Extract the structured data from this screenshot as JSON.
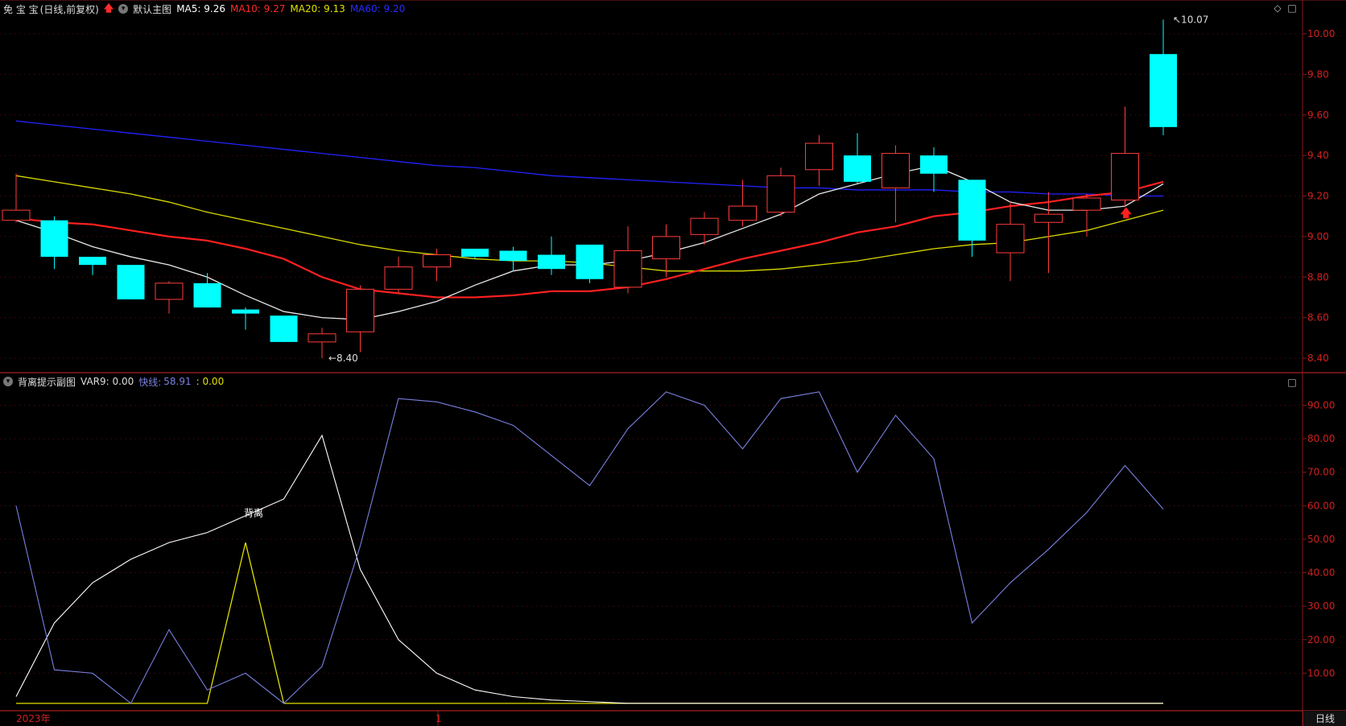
{
  "main_header": {
    "stock_name": "免 宝 宝",
    "period": "(日线,前复权)",
    "template": "默认主图",
    "ma5": "MA5: 9.26",
    "ma10": "MA10: 9.27",
    "ma20": "MA20: 9.13",
    "ma60": "MA60: 9.20",
    "colors": {
      "ma5": "#ffffff",
      "ma10": "#ff2a2a",
      "ma20": "#e0e000",
      "ma60": "#2222ff"
    }
  },
  "sub_header": {
    "title": "背离提示副图",
    "var9": "VAR9: 0.00",
    "fast_label": "快线:",
    "fast_value": "58.91",
    "yellow_value": ": 0.00"
  },
  "bottom": {
    "year_label": "2023年",
    "month_label": "1",
    "period_button": "日线"
  },
  "annotations": {
    "high": "10.07",
    "low": "←8.40",
    "divergence": "背离"
  },
  "chart_data": [
    {
      "type": "candlestick",
      "ylim": [
        8.32,
        10.1
      ],
      "yticks": [
        "10.00",
        "9.80",
        "9.60",
        "9.40",
        "9.20",
        "9.00",
        "8.80",
        "8.60",
        "8.40"
      ],
      "ytick_values": [
        10.0,
        9.8,
        9.6,
        9.4,
        9.2,
        9.0,
        8.8,
        8.6,
        8.4
      ],
      "candles": [
        {
          "o": 9.08,
          "h": 9.31,
          "l": 9.07,
          "c": 9.13
        },
        {
          "o": 9.08,
          "h": 9.1,
          "l": 8.84,
          "c": 8.9
        },
        {
          "o": 8.9,
          "h": 8.9,
          "l": 8.81,
          "c": 8.86
        },
        {
          "o": 8.86,
          "h": 8.86,
          "l": 8.69,
          "c": 8.69
        },
        {
          "o": 8.69,
          "h": 8.78,
          "l": 8.62,
          "c": 8.77
        },
        {
          "o": 8.77,
          "h": 8.82,
          "l": 8.65,
          "c": 8.65
        },
        {
          "o": 8.64,
          "h": 8.65,
          "l": 8.54,
          "c": 8.62
        },
        {
          "o": 8.61,
          "h": 8.61,
          "l": 8.48,
          "c": 8.48
        },
        {
          "o": 8.48,
          "h": 8.55,
          "l": 8.4,
          "c": 8.52
        },
        {
          "o": 8.53,
          "h": 8.76,
          "l": 8.43,
          "c": 8.74
        },
        {
          "o": 8.74,
          "h": 8.9,
          "l": 8.72,
          "c": 8.85
        },
        {
          "o": 8.85,
          "h": 8.94,
          "l": 8.78,
          "c": 8.91
        },
        {
          "o": 8.94,
          "h": 8.94,
          "l": 8.89,
          "c": 8.9
        },
        {
          "o": 8.93,
          "h": 8.95,
          "l": 8.83,
          "c": 8.88
        },
        {
          "o": 8.91,
          "h": 9.0,
          "l": 8.81,
          "c": 8.84
        },
        {
          "o": 8.96,
          "h": 8.96,
          "l": 8.77,
          "c": 8.79
        },
        {
          "o": 8.75,
          "h": 9.05,
          "l": 8.72,
          "c": 8.93
        },
        {
          "o": 8.89,
          "h": 9.06,
          "l": 8.8,
          "c": 9.0
        },
        {
          "o": 9.01,
          "h": 9.12,
          "l": 8.96,
          "c": 9.09
        },
        {
          "o": 9.08,
          "h": 9.28,
          "l": 9.05,
          "c": 9.15
        },
        {
          "o": 9.12,
          "h": 9.34,
          "l": 9.1,
          "c": 9.3
        },
        {
          "o": 9.33,
          "h": 9.5,
          "l": 9.25,
          "c": 9.46
        },
        {
          "o": 9.4,
          "h": 9.51,
          "l": 9.26,
          "c": 9.27
        },
        {
          "o": 9.24,
          "h": 9.45,
          "l": 9.07,
          "c": 9.41
        },
        {
          "o": 9.4,
          "h": 9.44,
          "l": 9.22,
          "c": 9.31
        },
        {
          "o": 9.28,
          "h": 9.28,
          "l": 8.9,
          "c": 8.98
        },
        {
          "o": 8.92,
          "h": 9.17,
          "l": 8.78,
          "c": 9.06
        },
        {
          "o": 9.07,
          "h": 9.22,
          "l": 8.82,
          "c": 9.11
        },
        {
          "o": 9.13,
          "h": 9.21,
          "l": 9.0,
          "c": 9.19
        },
        {
          "o": 9.18,
          "h": 9.64,
          "l": 9.15,
          "c": 9.41
        },
        {
          "o": 9.9,
          "h": 10.07,
          "l": 9.5,
          "c": 9.54
        }
      ],
      "ma5": [
        9.08,
        9.02,
        8.95,
        8.9,
        8.86,
        8.8,
        8.71,
        8.63,
        8.6,
        8.59,
        8.63,
        8.68,
        8.76,
        8.83,
        8.86,
        8.86,
        8.88,
        8.92,
        8.97,
        9.04,
        9.11,
        9.21,
        9.26,
        9.31,
        9.35,
        9.27,
        9.17,
        9.13,
        9.13,
        9.15,
        9.26
      ],
      "ma10": [
        9.09,
        9.07,
        9.06,
        9.03,
        9.0,
        8.98,
        8.94,
        8.89,
        8.8,
        8.74,
        8.72,
        8.7,
        8.7,
        8.71,
        8.73,
        8.73,
        8.75,
        8.79,
        8.84,
        8.89,
        8.93,
        8.97,
        9.02,
        9.05,
        9.1,
        9.12,
        9.15,
        9.17,
        9.2,
        9.22,
        9.27
      ],
      "ma20": [
        9.3,
        9.27,
        9.24,
        9.21,
        9.17,
        9.12,
        9.08,
        9.04,
        9.0,
        8.96,
        8.93,
        8.91,
        8.89,
        8.88,
        8.88,
        8.87,
        8.85,
        8.83,
        8.83,
        8.83,
        8.84,
        8.86,
        8.88,
        8.91,
        8.94,
        8.96,
        8.97,
        9.0,
        9.03,
        9.08,
        9.13
      ],
      "ma60": [
        9.57,
        9.55,
        9.53,
        9.51,
        9.49,
        9.47,
        9.45,
        9.43,
        9.41,
        9.39,
        9.37,
        9.35,
        9.34,
        9.32,
        9.3,
        9.29,
        9.28,
        9.27,
        9.26,
        9.25,
        9.24,
        9.24,
        9.23,
        9.23,
        9.23,
        9.22,
        9.22,
        9.21,
        9.21,
        9.2,
        9.2
      ]
    },
    {
      "type": "line",
      "ylim": [
        0,
        97
      ],
      "yticks": [
        "90.00",
        "80.00",
        "70.00",
        "60.00",
        "50.00",
        "40.00",
        "30.00",
        "20.00",
        "10.00"
      ],
      "ytick_values": [
        90,
        80,
        70,
        60,
        50,
        40,
        30,
        20,
        10
      ],
      "series": [
        {
          "color": "#7a80e0",
          "values": [
            60,
            11,
            10,
            1,
            23,
            5,
            10,
            1,
            12,
            48,
            92,
            91,
            88,
            84,
            75,
            66,
            83,
            94,
            90,
            77,
            92,
            94,
            70,
            87,
            74,
            25,
            37,
            47,
            58,
            72,
            59
          ]
        },
        {
          "color": "#ffffff",
          "values": [
            3,
            25,
            37,
            44,
            49,
            52,
            57,
            62,
            81,
            41,
            20,
            10,
            5,
            3,
            2,
            1.5,
            1,
            1,
            1,
            1,
            1,
            1,
            1,
            1,
            1,
            1,
            1,
            1,
            1,
            1,
            1
          ]
        },
        {
          "color": "#e0e000",
          "values": [
            1,
            1,
            1,
            1,
            1,
            1,
            49,
            1,
            1,
            1,
            1,
            1,
            1,
            1,
            1,
            1,
            1,
            1,
            1,
            1,
            1,
            1,
            1,
            1,
            1,
            1,
            1,
            1,
            1,
            1,
            1
          ]
        }
      ]
    }
  ]
}
